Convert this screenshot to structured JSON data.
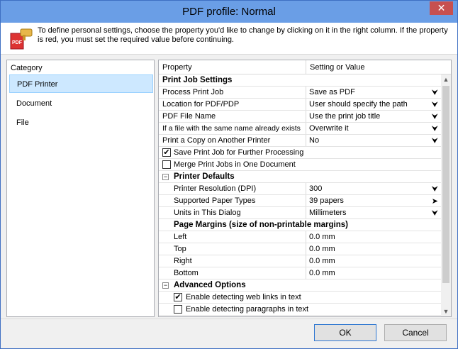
{
  "window": {
    "title": "PDF profile: Normal",
    "close_glyph": "✕"
  },
  "info": {
    "icon": "pdf-settings-icon",
    "text": "To define personal settings, choose the property you'd like to change by clicking on it in the right column. If the property is red, you must set the required value before continuing."
  },
  "categories": {
    "header": "Category",
    "items": [
      "PDF Printer",
      "Document",
      "File"
    ],
    "selected": "PDF Printer"
  },
  "props": {
    "header_property": "Property",
    "header_value": "Setting or Value",
    "print_job": {
      "title": "Print Job Settings",
      "rows": [
        {
          "label": "Process Print Job",
          "value": "Save as PDF"
        },
        {
          "label": "Location for PDF/PDP",
          "value": "User should specify the path"
        },
        {
          "label": "PDF File Name",
          "value": "Use the print job title"
        },
        {
          "label": "If a file with the same name already exists",
          "value": "Overwrite it"
        },
        {
          "label": "Print a Copy on Another Printer",
          "value": "No"
        }
      ],
      "checks": [
        {
          "label": "Save Print Job for Further Processing",
          "checked": true
        },
        {
          "label": "Merge Print Jobs in One Document",
          "checked": false
        }
      ]
    },
    "printer_defaults": {
      "title": "Printer Defaults",
      "collapse_glyph": "−",
      "rows": [
        {
          "label": "Printer Resolution (DPI)",
          "value": "300"
        },
        {
          "label": "Supported Paper Types",
          "value": "39 papers"
        },
        {
          "label": "Units in This Dialog",
          "value": "Millimeters"
        }
      ]
    },
    "page_margins": {
      "title": "Page Margins (size of non-printable margins)",
      "rows": [
        {
          "label": "Left",
          "value": "0.0 mm"
        },
        {
          "label": "Top",
          "value": "0.0 mm"
        },
        {
          "label": "Right",
          "value": "0.0 mm"
        },
        {
          "label": "Bottom",
          "value": "0.0 mm"
        }
      ]
    },
    "advanced": {
      "title": "Advanced Options",
      "collapse_glyph": "−",
      "checks": [
        {
          "label": "Enable detecting web links in text",
          "checked": true
        },
        {
          "label": "Enable detecting paragraphs in text",
          "checked": false
        }
      ]
    },
    "dropdown_glyph": "⮟",
    "arrow_glyph": "➤",
    "check_glyph": "✔"
  },
  "footer": {
    "ok_label": "OK",
    "cancel_label": "Cancel"
  },
  "colors": {
    "titlebar": "#6a9ee6",
    "selected_category": "#cde8ff",
    "close_button": "#c75050"
  }
}
